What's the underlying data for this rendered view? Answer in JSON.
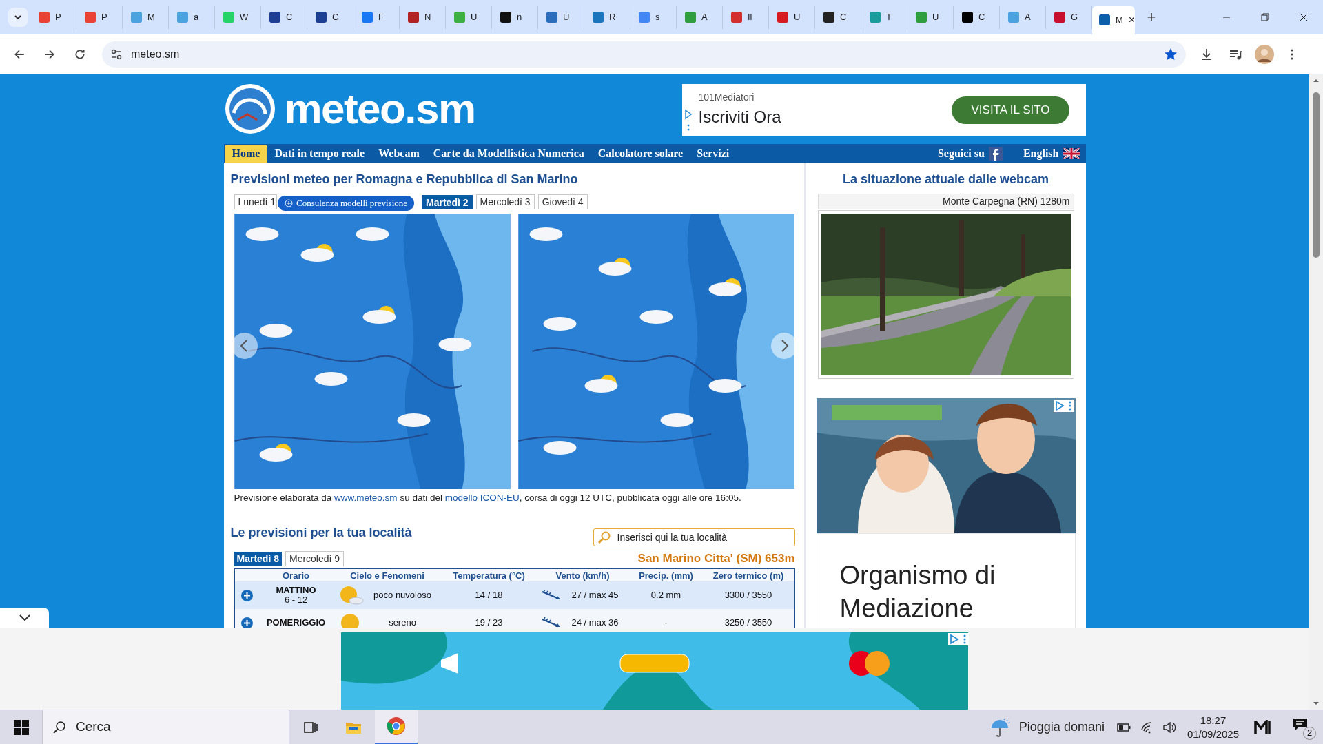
{
  "browser": {
    "tabs": [
      {
        "label": "P",
        "color": "#ea4335",
        "selected": false
      },
      {
        "label": "P",
        "color": "#ea4335",
        "selected": false
      },
      {
        "label": "M",
        "color": "#4aa3df",
        "selected": false
      },
      {
        "label": "a",
        "color": "#4aa3df",
        "selected": false
      },
      {
        "label": "W",
        "color": "#25d366",
        "selected": false
      },
      {
        "label": "C",
        "color": "#1c3f94",
        "selected": false
      },
      {
        "label": "C",
        "color": "#1c3f94",
        "selected": false
      },
      {
        "label": "F",
        "color": "#1877f2",
        "selected": false
      },
      {
        "label": "N",
        "color": "#b22222",
        "selected": false
      },
      {
        "label": "U",
        "color": "#3cb043",
        "selected": false
      },
      {
        "label": "n",
        "color": "#111111",
        "selected": false
      },
      {
        "label": "U",
        "color": "#2a6ebb",
        "selected": false
      },
      {
        "label": "R",
        "color": "#1b75bc",
        "selected": false
      },
      {
        "label": "s",
        "color": "#4285f4",
        "selected": false
      },
      {
        "label": "A",
        "color": "#2e9e3e",
        "selected": false
      },
      {
        "label": "Il",
        "color": "#d32f2f",
        "selected": false
      },
      {
        "label": "U",
        "color": "#d71920",
        "selected": false
      },
      {
        "label": "C",
        "color": "#222222",
        "selected": false
      },
      {
        "label": "T",
        "color": "#1a9c9c",
        "selected": false
      },
      {
        "label": "U",
        "color": "#2e9e3e",
        "selected": false
      },
      {
        "label": "C",
        "color": "#000000",
        "selected": false
      },
      {
        "label": "A",
        "color": "#4aa3df",
        "selected": false
      },
      {
        "label": "G",
        "color": "#c8102e",
        "selected": false
      },
      {
        "label": "M",
        "color": "#0c5eaa",
        "selected": true
      }
    ],
    "close": "×",
    "new_tab": "+",
    "address": "meteo.sm"
  },
  "site": {
    "logo": "meteo.sm",
    "top_ad": {
      "advertiser": "101Mediatori",
      "headline": "Iscriviti Ora",
      "button": "VISITA IL SITO"
    },
    "nav": {
      "items": [
        {
          "label": "Home",
          "selected": true
        },
        {
          "label": "Dati in tempo reale",
          "selected": false
        },
        {
          "label": "Webcam",
          "selected": false
        },
        {
          "label": "Carte da Modellistica Numerica",
          "selected": false
        },
        {
          "label": "Calcolatore solare",
          "selected": false
        },
        {
          "label": "Servizi",
          "selected": false
        }
      ],
      "follow": "Seguici su",
      "language": "English"
    },
    "forecast": {
      "title": "Previsioni meteo per Romagna e Repubblica di San Marino",
      "tabs": [
        {
          "label": "Lunedì 1",
          "selected": false
        },
        {
          "label": "Martedì 2",
          "selected": true
        },
        {
          "label": "Mercoledì 3",
          "selected": false
        },
        {
          "label": "Giovedì 4",
          "selected": false
        }
      ],
      "overlay_button": "Consulenza modelli previsione",
      "caption": [
        {
          "text": "Previsione elaborata da ",
          "link": false
        },
        {
          "text": "www.meteo.sm",
          "link": true
        },
        {
          "text": " su dati del ",
          "link": false
        },
        {
          "text": "modello ICON-EU",
          "link": true
        },
        {
          "text": ", corsa di oggi 12 UTC, pubblicata oggi alle ore 16:05.",
          "link": false
        }
      ]
    },
    "local": {
      "title": "Le previsioni per la tua località",
      "search_placeholder": "Inserisci qui la tua località",
      "tabs": [
        {
          "label": "Martedì 8",
          "selected": true
        },
        {
          "label": "Mercoledì 9",
          "selected": false
        }
      ],
      "location": "San Marino Citta' (SM) 653m",
      "columns": [
        "Orario",
        "Cielo e Fenomeni",
        "Temperatura (°C)",
        "Vento (km/h)",
        "Precip. (mm)",
        "Zero termico (m)"
      ],
      "rows": [
        {
          "period": "MATTINO",
          "hours": "6 - 12",
          "kind": "partly-cloudy",
          "description": "poco nuvoloso",
          "temperature": "14 / 18",
          "wind": "27 / max 45",
          "precip": "0.2 mm",
          "freezing": "3300 / 3550"
        },
        {
          "period": "POMERIGGIO",
          "kind": "sunny",
          "description": "sereno",
          "temperature": "19 / 23",
          "wind": "24 / max 36",
          "precip": "-",
          "freezing": "3250 / 3550"
        }
      ]
    },
    "webcam": {
      "title": "La situazione attuale dalle webcam",
      "caption": "Monte Carpegna (RN) 1280m"
    },
    "side_ad": {
      "headline": "Organismo di Mediazione"
    }
  },
  "taskbar": {
    "search": "Cerca",
    "weather": "Pioggia domani",
    "time": "18:27",
    "date": "01/09/2025",
    "notifications": "2"
  }
}
